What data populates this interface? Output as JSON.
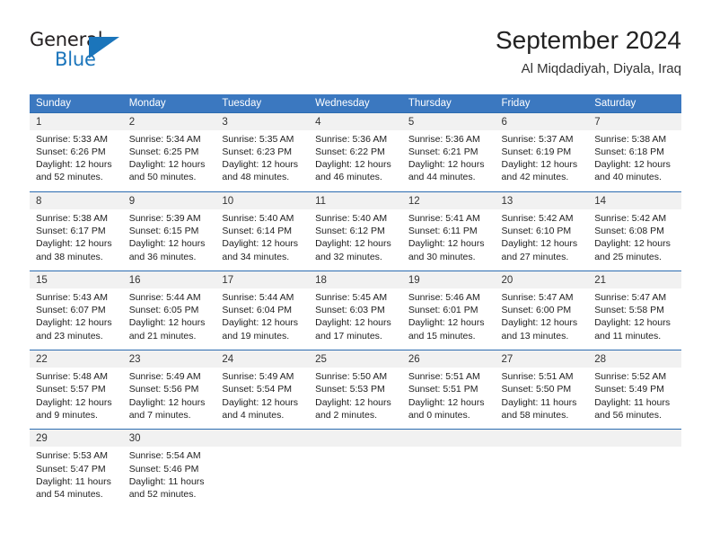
{
  "brand": {
    "name_part1": "General",
    "name_part2": "Blue",
    "logo_icon": "triangle-logo-icon",
    "accent_color": "#1b75bb"
  },
  "header": {
    "title": "September 2024",
    "location": "Al Miqdadiyah, Diyala, Iraq"
  },
  "calendar": {
    "header_background": "#3b78c0",
    "daynum_background": "#f1f1f1",
    "row_divider_color": "#2c6cb0",
    "weekday_headers": [
      "Sunday",
      "Monday",
      "Tuesday",
      "Wednesday",
      "Thursday",
      "Friday",
      "Saturday"
    ],
    "weeks": [
      [
        {
          "day": "1",
          "sunrise": "Sunrise: 5:33 AM",
          "sunset": "Sunset: 6:26 PM",
          "daylight_line1": "Daylight: 12 hours",
          "daylight_line2": "and 52 minutes."
        },
        {
          "day": "2",
          "sunrise": "Sunrise: 5:34 AM",
          "sunset": "Sunset: 6:25 PM",
          "daylight_line1": "Daylight: 12 hours",
          "daylight_line2": "and 50 minutes."
        },
        {
          "day": "3",
          "sunrise": "Sunrise: 5:35 AM",
          "sunset": "Sunset: 6:23 PM",
          "daylight_line1": "Daylight: 12 hours",
          "daylight_line2": "and 48 minutes."
        },
        {
          "day": "4",
          "sunrise": "Sunrise: 5:36 AM",
          "sunset": "Sunset: 6:22 PM",
          "daylight_line1": "Daylight: 12 hours",
          "daylight_line2": "and 46 minutes."
        },
        {
          "day": "5",
          "sunrise": "Sunrise: 5:36 AM",
          "sunset": "Sunset: 6:21 PM",
          "daylight_line1": "Daylight: 12 hours",
          "daylight_line2": "and 44 minutes."
        },
        {
          "day": "6",
          "sunrise": "Sunrise: 5:37 AM",
          "sunset": "Sunset: 6:19 PM",
          "daylight_line1": "Daylight: 12 hours",
          "daylight_line2": "and 42 minutes."
        },
        {
          "day": "7",
          "sunrise": "Sunrise: 5:38 AM",
          "sunset": "Sunset: 6:18 PM",
          "daylight_line1": "Daylight: 12 hours",
          "daylight_line2": "and 40 minutes."
        }
      ],
      [
        {
          "day": "8",
          "sunrise": "Sunrise: 5:38 AM",
          "sunset": "Sunset: 6:17 PM",
          "daylight_line1": "Daylight: 12 hours",
          "daylight_line2": "and 38 minutes."
        },
        {
          "day": "9",
          "sunrise": "Sunrise: 5:39 AM",
          "sunset": "Sunset: 6:15 PM",
          "daylight_line1": "Daylight: 12 hours",
          "daylight_line2": "and 36 minutes."
        },
        {
          "day": "10",
          "sunrise": "Sunrise: 5:40 AM",
          "sunset": "Sunset: 6:14 PM",
          "daylight_line1": "Daylight: 12 hours",
          "daylight_line2": "and 34 minutes."
        },
        {
          "day": "11",
          "sunrise": "Sunrise: 5:40 AM",
          "sunset": "Sunset: 6:12 PM",
          "daylight_line1": "Daylight: 12 hours",
          "daylight_line2": "and 32 minutes."
        },
        {
          "day": "12",
          "sunrise": "Sunrise: 5:41 AM",
          "sunset": "Sunset: 6:11 PM",
          "daylight_line1": "Daylight: 12 hours",
          "daylight_line2": "and 30 minutes."
        },
        {
          "day": "13",
          "sunrise": "Sunrise: 5:42 AM",
          "sunset": "Sunset: 6:10 PM",
          "daylight_line1": "Daylight: 12 hours",
          "daylight_line2": "and 27 minutes."
        },
        {
          "day": "14",
          "sunrise": "Sunrise: 5:42 AM",
          "sunset": "Sunset: 6:08 PM",
          "daylight_line1": "Daylight: 12 hours",
          "daylight_line2": "and 25 minutes."
        }
      ],
      [
        {
          "day": "15",
          "sunrise": "Sunrise: 5:43 AM",
          "sunset": "Sunset: 6:07 PM",
          "daylight_line1": "Daylight: 12 hours",
          "daylight_line2": "and 23 minutes."
        },
        {
          "day": "16",
          "sunrise": "Sunrise: 5:44 AM",
          "sunset": "Sunset: 6:05 PM",
          "daylight_line1": "Daylight: 12 hours",
          "daylight_line2": "and 21 minutes."
        },
        {
          "day": "17",
          "sunrise": "Sunrise: 5:44 AM",
          "sunset": "Sunset: 6:04 PM",
          "daylight_line1": "Daylight: 12 hours",
          "daylight_line2": "and 19 minutes."
        },
        {
          "day": "18",
          "sunrise": "Sunrise: 5:45 AM",
          "sunset": "Sunset: 6:03 PM",
          "daylight_line1": "Daylight: 12 hours",
          "daylight_line2": "and 17 minutes."
        },
        {
          "day": "19",
          "sunrise": "Sunrise: 5:46 AM",
          "sunset": "Sunset: 6:01 PM",
          "daylight_line1": "Daylight: 12 hours",
          "daylight_line2": "and 15 minutes."
        },
        {
          "day": "20",
          "sunrise": "Sunrise: 5:47 AM",
          "sunset": "Sunset: 6:00 PM",
          "daylight_line1": "Daylight: 12 hours",
          "daylight_line2": "and 13 minutes."
        },
        {
          "day": "21",
          "sunrise": "Sunrise: 5:47 AM",
          "sunset": "Sunset: 5:58 PM",
          "daylight_line1": "Daylight: 12 hours",
          "daylight_line2": "and 11 minutes."
        }
      ],
      [
        {
          "day": "22",
          "sunrise": "Sunrise: 5:48 AM",
          "sunset": "Sunset: 5:57 PM",
          "daylight_line1": "Daylight: 12 hours",
          "daylight_line2": "and 9 minutes."
        },
        {
          "day": "23",
          "sunrise": "Sunrise: 5:49 AM",
          "sunset": "Sunset: 5:56 PM",
          "daylight_line1": "Daylight: 12 hours",
          "daylight_line2": "and 7 minutes."
        },
        {
          "day": "24",
          "sunrise": "Sunrise: 5:49 AM",
          "sunset": "Sunset: 5:54 PM",
          "daylight_line1": "Daylight: 12 hours",
          "daylight_line2": "and 4 minutes."
        },
        {
          "day": "25",
          "sunrise": "Sunrise: 5:50 AM",
          "sunset": "Sunset: 5:53 PM",
          "daylight_line1": "Daylight: 12 hours",
          "daylight_line2": "and 2 minutes."
        },
        {
          "day": "26",
          "sunrise": "Sunrise: 5:51 AM",
          "sunset": "Sunset: 5:51 PM",
          "daylight_line1": "Daylight: 12 hours",
          "daylight_line2": "and 0 minutes."
        },
        {
          "day": "27",
          "sunrise": "Sunrise: 5:51 AM",
          "sunset": "Sunset: 5:50 PM",
          "daylight_line1": "Daylight: 11 hours",
          "daylight_line2": "and 58 minutes."
        },
        {
          "day": "28",
          "sunrise": "Sunrise: 5:52 AM",
          "sunset": "Sunset: 5:49 PM",
          "daylight_line1": "Daylight: 11 hours",
          "daylight_line2": "and 56 minutes."
        }
      ],
      [
        {
          "day": "29",
          "sunrise": "Sunrise: 5:53 AM",
          "sunset": "Sunset: 5:47 PM",
          "daylight_line1": "Daylight: 11 hours",
          "daylight_line2": "and 54 minutes."
        },
        {
          "day": "30",
          "sunrise": "Sunrise: 5:54 AM",
          "sunset": "Sunset: 5:46 PM",
          "daylight_line1": "Daylight: 11 hours",
          "daylight_line2": "and 52 minutes."
        },
        {
          "day": "",
          "sunrise": "",
          "sunset": "",
          "daylight_line1": "",
          "daylight_line2": ""
        },
        {
          "day": "",
          "sunrise": "",
          "sunset": "",
          "daylight_line1": "",
          "daylight_line2": ""
        },
        {
          "day": "",
          "sunrise": "",
          "sunset": "",
          "daylight_line1": "",
          "daylight_line2": ""
        },
        {
          "day": "",
          "sunrise": "",
          "sunset": "",
          "daylight_line1": "",
          "daylight_line2": ""
        },
        {
          "day": "",
          "sunrise": "",
          "sunset": "",
          "daylight_line1": "",
          "daylight_line2": ""
        }
      ]
    ]
  }
}
